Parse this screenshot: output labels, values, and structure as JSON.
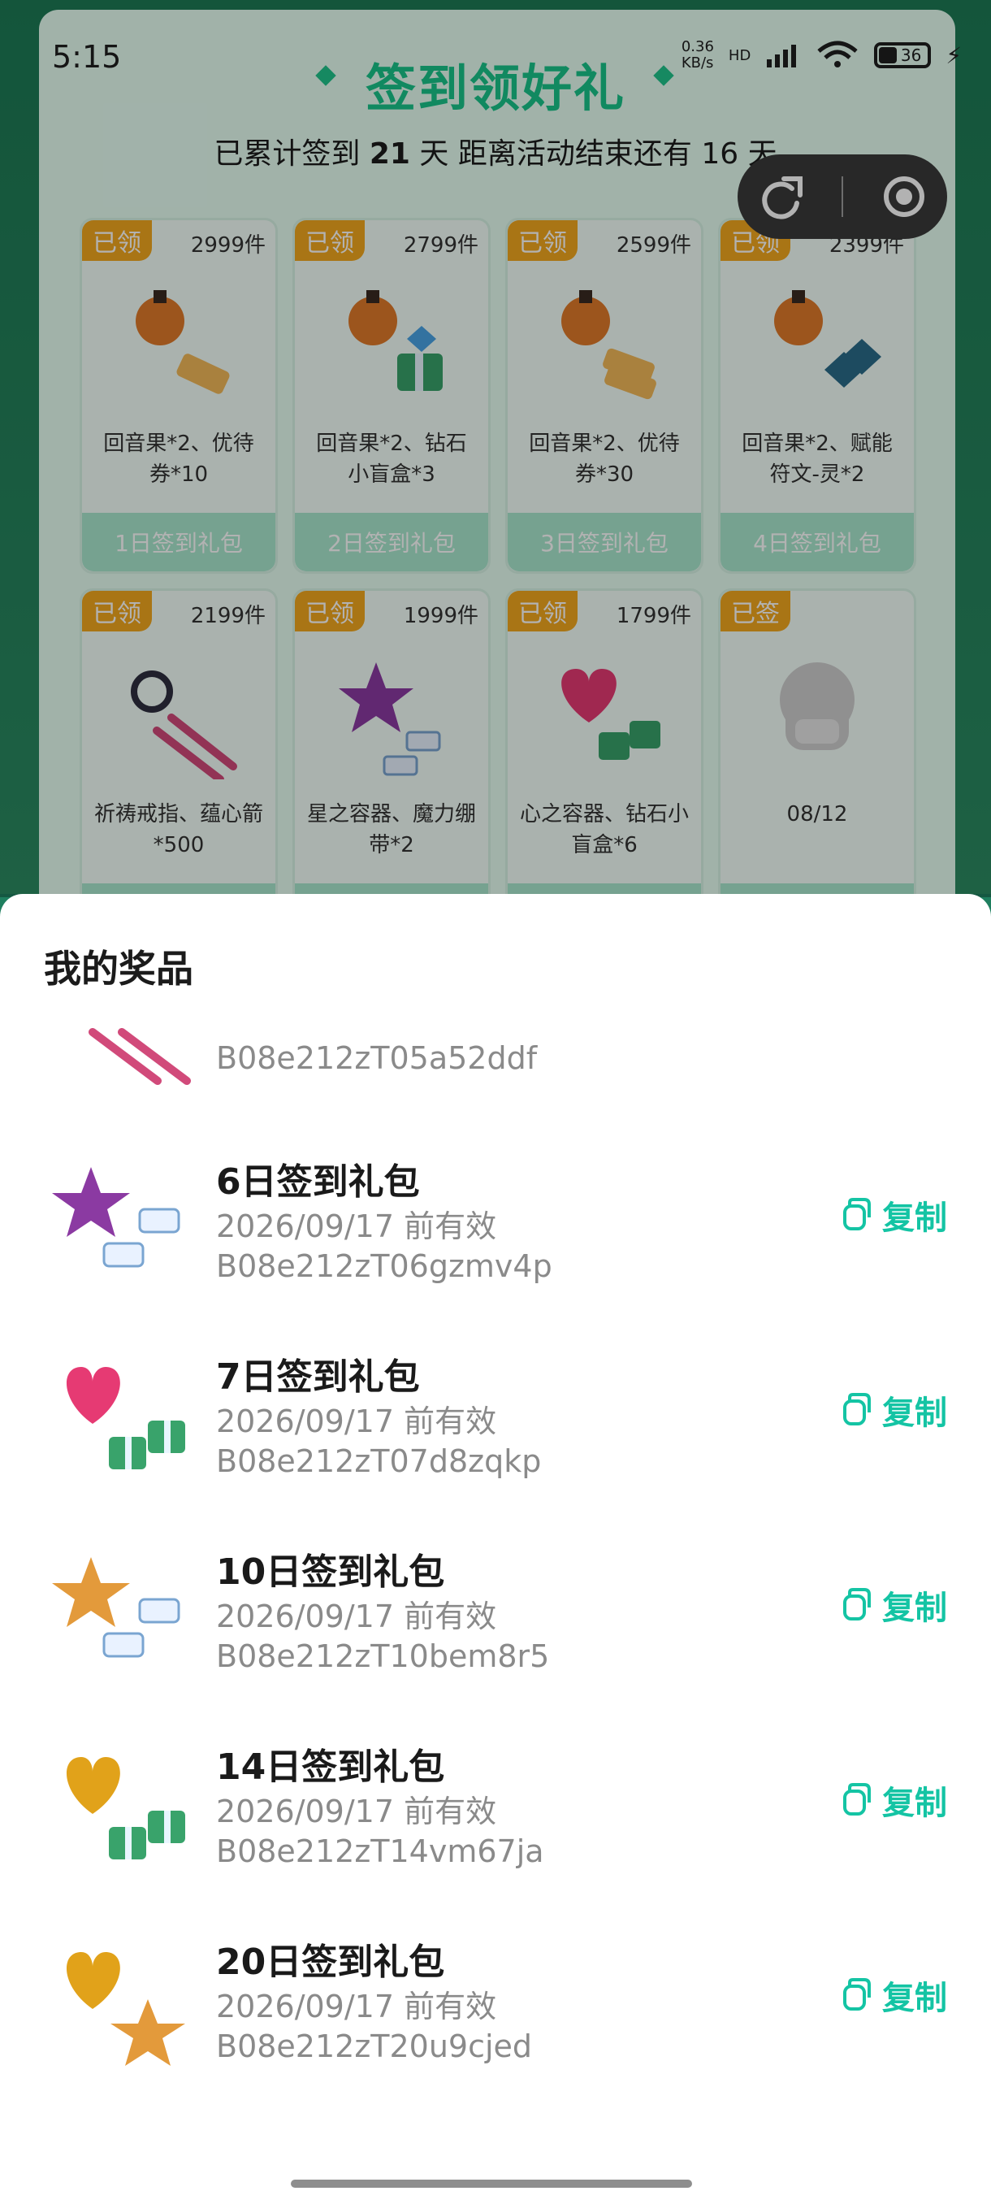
{
  "status_bar": {
    "time": "5:15",
    "speed": "0.36\nKB/s",
    "hd": "HD",
    "battery": "36"
  },
  "background": {
    "title": "签到领好礼",
    "subtitle_prefix": "已累计签到 ",
    "days": "21",
    "subtitle_mid": " 天  距离活动结束还有 ",
    "remaining": "16",
    "subtitle_suffix": " 天",
    "gifts": [
      {
        "tag": "已领",
        "count": "2999件",
        "desc": "回音果*2、优待券*10",
        "foot": "1日签到礼包"
      },
      {
        "tag": "已领",
        "count": "2799件",
        "desc": "回音果*2、钻石小盲盒*3",
        "foot": "2日签到礼包"
      },
      {
        "tag": "已领",
        "count": "2599件",
        "desc": "回音果*2、优待券*30",
        "foot": "3日签到礼包"
      },
      {
        "tag": "已领",
        "count": "2399件",
        "desc": "回音果*2、赋能符文-灵*2",
        "foot": "4日签到礼包"
      },
      {
        "tag": "已领",
        "count": "2199件",
        "desc": "祈祷戒指、蕴心箭*500",
        "foot": ""
      },
      {
        "tag": "已领",
        "count": "1999件",
        "desc": "星之容器、魔力绷带*2",
        "foot": ""
      },
      {
        "tag": "已领",
        "count": "1799件",
        "desc": "心之容器、钻石小盲盒*6",
        "foot": ""
      },
      {
        "tag": "已签",
        "count": "",
        "desc": "08/12",
        "foot": ""
      }
    ]
  },
  "sheet": {
    "title": "我的奖品",
    "partial_code": "B08e212zT05a52ddf",
    "items": [
      {
        "title": "6日签到礼包",
        "date": "2026/09/17 前有效",
        "code": "B08e212zT06gzmv4p",
        "copy": "复制",
        "icon": "purple-star-and-bandages"
      },
      {
        "title": "7日签到礼包",
        "date": "2026/09/17 前有效",
        "code": "B08e212zT07d8zqkp",
        "copy": "复制",
        "icon": "pink-heart-and-gift-boxes"
      },
      {
        "title": "10日签到礼包",
        "date": "2026/09/17 前有效",
        "code": "B08e212zT10bem8r5",
        "copy": "复制",
        "icon": "gold-star-and-bandages"
      },
      {
        "title": "14日签到礼包",
        "date": "2026/09/17 前有效",
        "code": "B08e212zT14vm67ja",
        "copy": "复制",
        "icon": "gold-heart-and-gift-boxes"
      },
      {
        "title": "20日签到礼包",
        "date": "2026/09/17 前有效",
        "code": "B08e212zT20u9cjed",
        "copy": "复制",
        "icon": "gold-heart-and-gold-star"
      }
    ]
  },
  "colors": {
    "accent_green": "#19c58a",
    "copy_teal": "#14c4a4",
    "tag_orange": "#f3a81f"
  }
}
